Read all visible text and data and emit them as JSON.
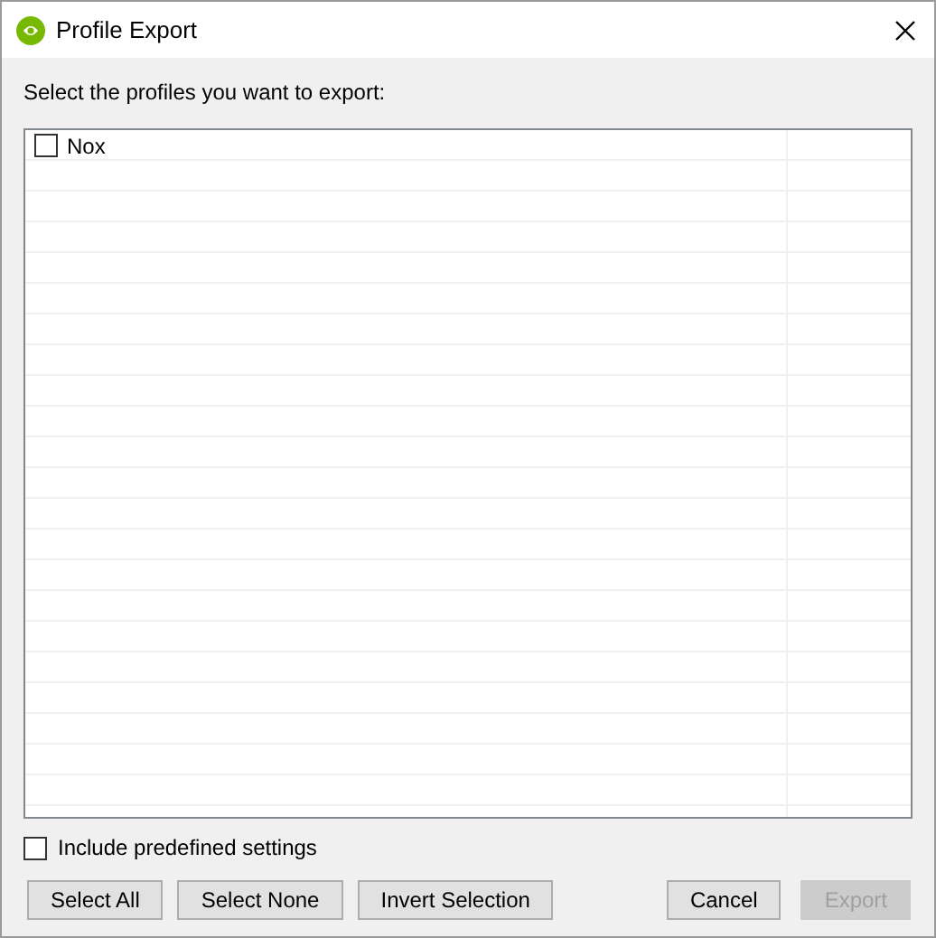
{
  "window": {
    "title": "Profile Export"
  },
  "prompt": "Select the profiles you want to export:",
  "profiles": [
    {
      "name": "Nox",
      "checked": false
    }
  ],
  "include_predefined": {
    "label": "Include predefined settings",
    "checked": false
  },
  "selection_buttons": [
    {
      "label": "Select All",
      "disabled": false
    },
    {
      "label": "Select None",
      "disabled": false
    },
    {
      "label": "Invert Selection",
      "disabled": false
    }
  ],
  "dialog_buttons": [
    {
      "label": "Cancel",
      "disabled": false
    },
    {
      "label": "Export",
      "disabled": true
    }
  ]
}
